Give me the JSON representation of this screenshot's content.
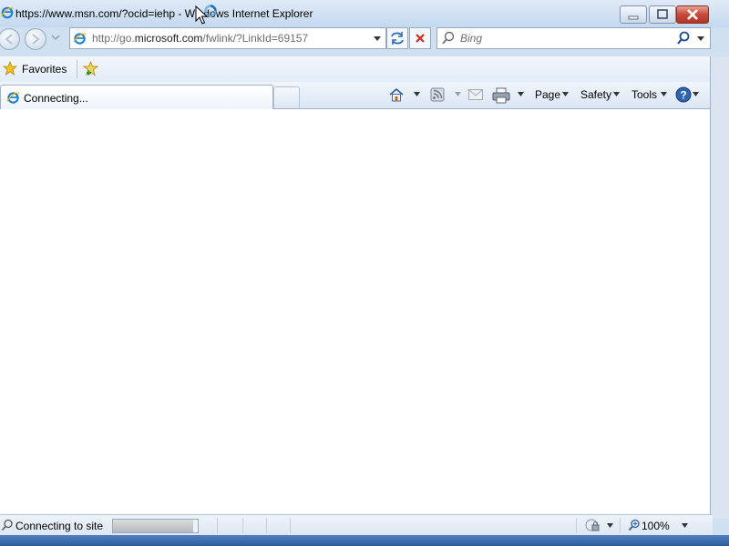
{
  "window": {
    "title": "https://www.msn.com/?ocid=iehp - Windows Internet Explorer"
  },
  "address_bar": {
    "url_prefix": "http://go.",
    "url_domain": "microsoft.com",
    "url_suffix": "/fwlink/?LinkId=69157"
  },
  "search": {
    "placeholder": "Bing"
  },
  "favorites_bar": {
    "favorites_label": "Favorites"
  },
  "tabs": [
    {
      "label": "Connecting...",
      "active": true
    }
  ],
  "command_bar": {
    "page_label": "Page",
    "safety_label": "Safety",
    "tools_label": "Tools"
  },
  "status_bar": {
    "status_text": "Connecting to site",
    "progress": 0.95,
    "zoom": "100%"
  },
  "colors": {
    "chrome": "#dbe6f3",
    "accent": "#2c5c9a",
    "close_red": "#c44a3a"
  }
}
